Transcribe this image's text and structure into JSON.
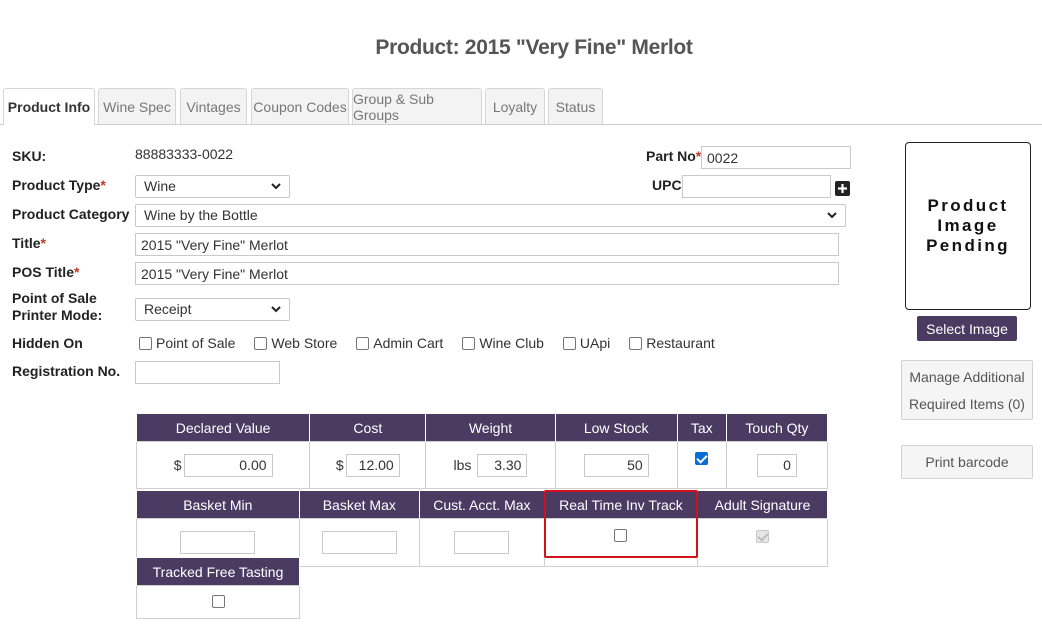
{
  "page_title": "Product: 2015 \"Very Fine\" Merlot",
  "tabs": [
    {
      "label": "Product Info",
      "active": true
    },
    {
      "label": "Wine Spec"
    },
    {
      "label": "Vintages"
    },
    {
      "label": "Coupon Codes"
    },
    {
      "label": "Group & Sub Groups"
    },
    {
      "label": "Loyalty"
    },
    {
      "label": "Status"
    }
  ],
  "form": {
    "sku_label": "SKU:",
    "sku_value": "88883333-0022",
    "part_no_label": "Part No",
    "part_no_value": "0022",
    "upc_label": "UPC",
    "upc_value": "",
    "product_type_label": "Product Type",
    "product_type_value": "Wine",
    "product_category_label": "Product Category",
    "product_category_value": "Wine by the Bottle",
    "title_label": "Title",
    "title_value": "2015 \"Very Fine\" Merlot",
    "pos_title_label": "POS Title",
    "pos_title_value": "2015 \"Very Fine\" Merlot",
    "pos_printer_label_line1": "Point of Sale",
    "pos_printer_label_line2": "Printer Mode:",
    "pos_printer_value": "Receipt",
    "hidden_on_label": "Hidden On",
    "hidden_on_options": [
      {
        "label": "Point of Sale",
        "checked": false
      },
      {
        "label": "Web Store",
        "checked": false
      },
      {
        "label": "Admin Cart",
        "checked": false
      },
      {
        "label": "Wine Club",
        "checked": false
      },
      {
        "label": "UApi",
        "checked": false
      },
      {
        "label": "Restaurant",
        "checked": false
      }
    ],
    "registration_label": "Registration No.",
    "registration_value": "",
    "required_marker": "*"
  },
  "table1": {
    "headers": [
      "Declared Value",
      "Cost",
      "Weight",
      "Low Stock",
      "Tax",
      "Touch Qty"
    ],
    "declared_prefix": "$",
    "declared_value": "0.00",
    "cost_prefix": "$",
    "cost_value": "12.00",
    "weight_unit": "lbs",
    "weight_value": "3.30",
    "low_stock_value": "50",
    "tax_checked": true,
    "touch_qty_value": "0"
  },
  "table2": {
    "headers": [
      "Basket Min",
      "Basket Max",
      "Cust. Acct. Max",
      "Real Time Inv Track",
      "Adult Signature"
    ],
    "basket_min": "",
    "basket_max": "",
    "cust_acct_max": "",
    "real_time_inv_checked": false,
    "adult_signature_checked": true,
    "adult_signature_disabled": true
  },
  "table3": {
    "headers": [
      "Tracked Free Tasting"
    ],
    "tracked_free_tasting_checked": false
  },
  "side": {
    "image_placeholder_line1": "Product",
    "image_placeholder_line2": "Image",
    "image_placeholder_line3": "Pending",
    "select_image_label": "Select Image",
    "manage_additional_line1": "Manage Additional",
    "manage_additional_line2": "Required Items (0)",
    "print_barcode_label": "Print barcode"
  },
  "icons": {
    "dropdown": "chevron-down-icon",
    "add": "plus-icon"
  },
  "colors": {
    "header_purple": "#4b3b63",
    "required_red": "#c0392b",
    "highlight_red": "#d0131b",
    "checkbox_blue": "#0a6cd6"
  }
}
